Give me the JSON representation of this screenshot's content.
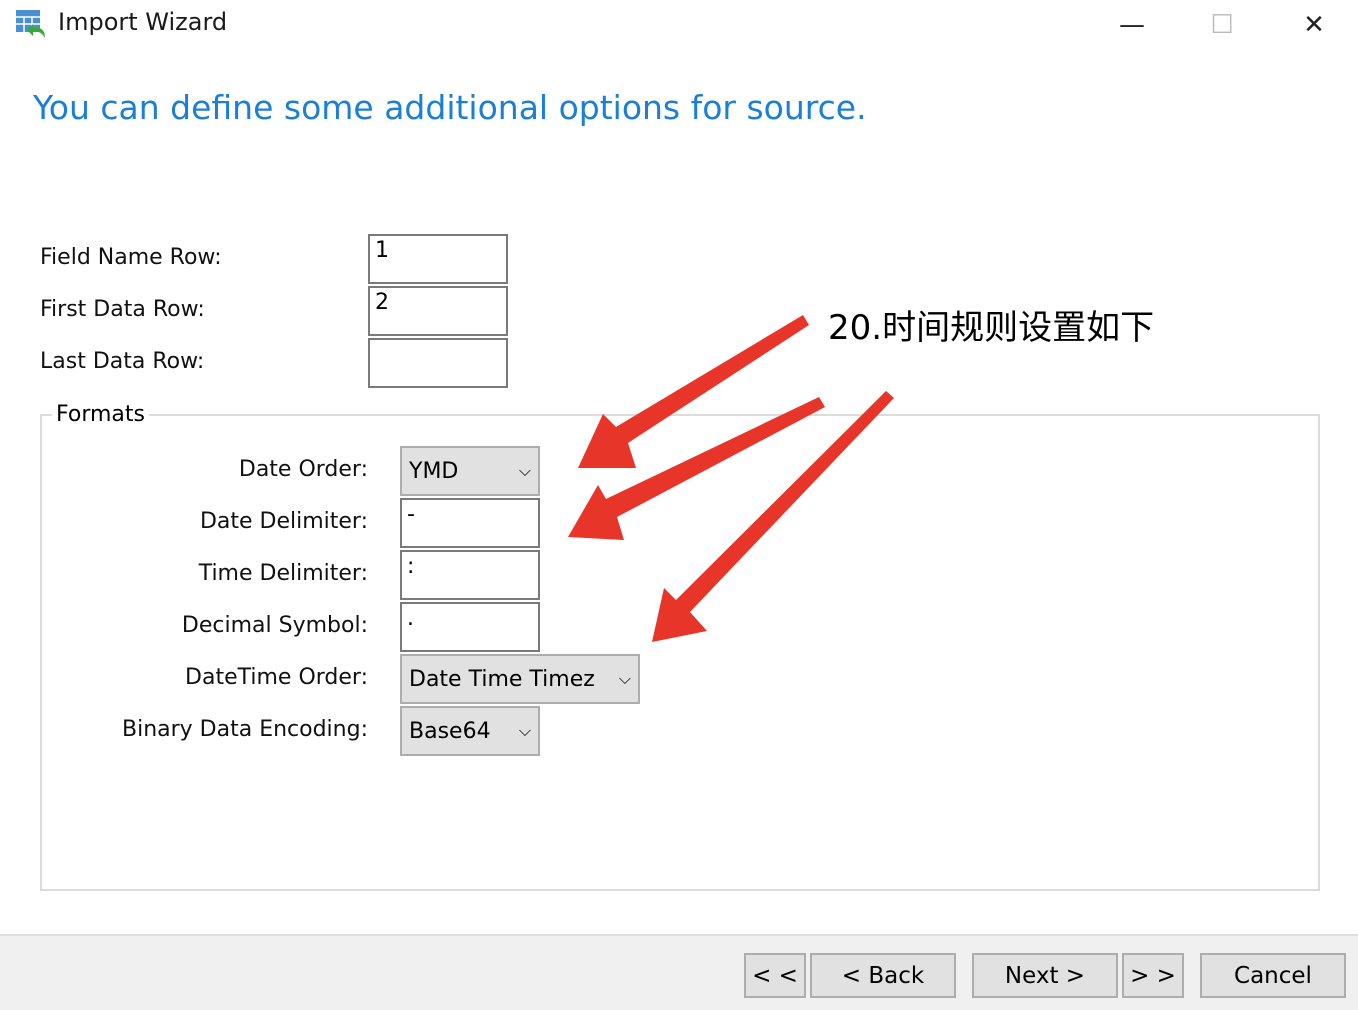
{
  "window": {
    "title": "Import Wizard",
    "app_icon": "table-import-icon",
    "minimize": "—",
    "maximize": "☐",
    "close": "✕"
  },
  "heading": "You can define some additional options for source.",
  "rows": {
    "field_name_row": {
      "label": "Field Name Row:",
      "value": "1"
    },
    "first_data_row": {
      "label": "First Data Row:",
      "value": "2"
    },
    "last_data_row": {
      "label": "Last Data Row:",
      "value": ""
    }
  },
  "formats": {
    "title": "Formats",
    "date_order": {
      "label": "Date Order:",
      "value": "YMD"
    },
    "date_delimiter": {
      "label": "Date Delimiter:",
      "value": "-"
    },
    "time_delimiter": {
      "label": "Time Delimiter:",
      "value": ":"
    },
    "decimal_symbol": {
      "label": "Decimal Symbol:",
      "value": "."
    },
    "datetime_order": {
      "label": "DateTime Order:",
      "value": "Date Time Timez"
    },
    "binary_encoding": {
      "label": "Binary Data Encoding:",
      "value": "Base64"
    }
  },
  "buttons": {
    "first": "< <",
    "back": "< Back",
    "next": "Next >",
    "last": "> >",
    "cancel": "Cancel"
  },
  "annotation": {
    "text": "20.时间规则设置如下",
    "color": "#e8352a"
  }
}
